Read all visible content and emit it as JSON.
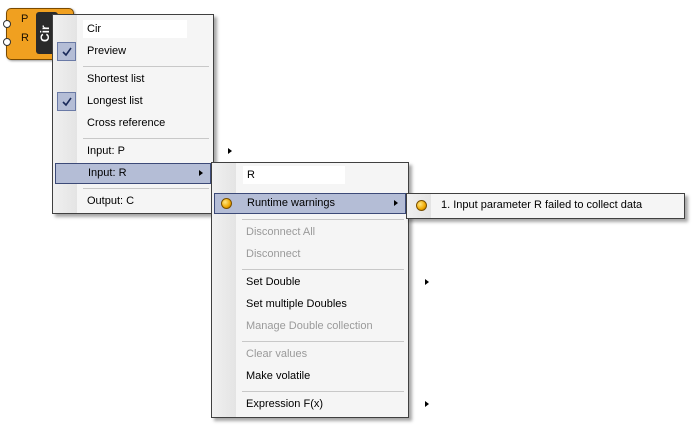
{
  "component": {
    "inputs": [
      "P",
      "R"
    ],
    "nickname": "Cir"
  },
  "main_menu": {
    "name_field": "Cir",
    "preview": "Preview",
    "shortest_list": "Shortest list",
    "longest_list": "Longest list",
    "cross_reference": "Cross reference",
    "input_p": "Input: P",
    "input_r": "Input: R",
    "output_c": "Output: C"
  },
  "param_menu": {
    "name_field": "R",
    "runtime_warnings": "Runtime warnings",
    "disconnect_all": "Disconnect All",
    "disconnect": "Disconnect",
    "set_double": "Set Double",
    "set_multiple_doubles": "Set multiple Doubles",
    "manage_double_collection": "Manage Double collection",
    "clear_values": "Clear values",
    "make_volatile": "Make volatile",
    "expression": "Expression F(x)"
  },
  "warnings_menu": {
    "items": [
      "1. Input parameter R failed to collect data"
    ]
  },
  "colors": {
    "highlight": "#b4bdd6",
    "highlight_border": "#3c4a78",
    "component": "#f0a020",
    "warning": "#f0a800"
  }
}
